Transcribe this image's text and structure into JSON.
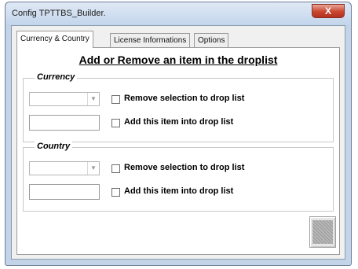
{
  "window": {
    "title": "Config TPTTBS_Builder.",
    "close_label": "X"
  },
  "tabs": [
    {
      "label": "Currency & Country",
      "active": true
    },
    {
      "label": "License Informations",
      "active": false
    },
    {
      "label": "Options",
      "active": false
    }
  ],
  "panel": {
    "heading": "Add or Remove an item in the droplist",
    "currency": {
      "label": "Currency",
      "dropdown_value": "",
      "remove_label": "Remove selection to drop list",
      "add_input_value": "",
      "add_label": "Add this item into drop list"
    },
    "country": {
      "label": "Country",
      "dropdown_value": "",
      "remove_label": "Remove selection to drop list",
      "add_input_value": "",
      "add_label": "Add this item into drop list"
    }
  },
  "icons": {
    "dropdown": "chevron-down-icon",
    "close": "close-icon",
    "action": "grey-image-icon"
  }
}
